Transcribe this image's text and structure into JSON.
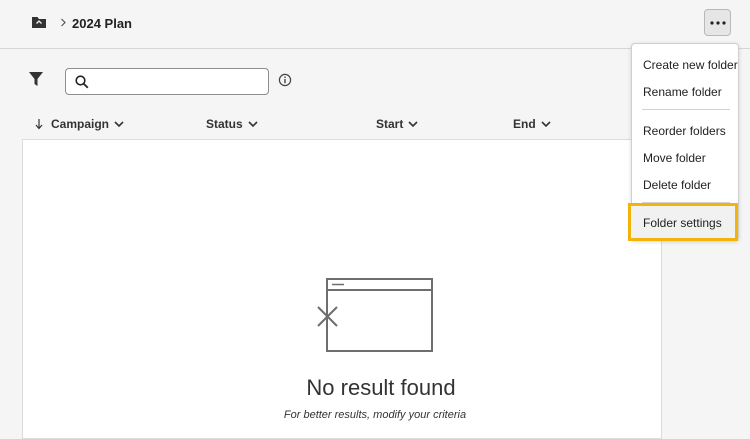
{
  "breadcrumb": {
    "current": "2024 Plan"
  },
  "toolbar": {
    "more_icon": "ellipsis-icon"
  },
  "search": {
    "value": "",
    "placeholder": ""
  },
  "table": {
    "columns": [
      {
        "label": "Campaign",
        "sorted": "descending"
      },
      {
        "label": "Status"
      },
      {
        "label": "Start"
      },
      {
        "label": "End"
      }
    ]
  },
  "empty_state": {
    "title": "No result found",
    "subtitle": "For better results, modify your criteria"
  },
  "menu": {
    "items": [
      {
        "label": "Create new folder"
      },
      {
        "label": "Rename folder"
      },
      {
        "label": "Reorder folders"
      },
      {
        "label": "Move folder"
      },
      {
        "label": "Delete folder"
      },
      {
        "label": "Folder settings",
        "highlighted": true
      }
    ]
  },
  "colors": {
    "highlight": "#f2b30a",
    "panel": "#ffffff",
    "background": "#f5f5f5"
  }
}
